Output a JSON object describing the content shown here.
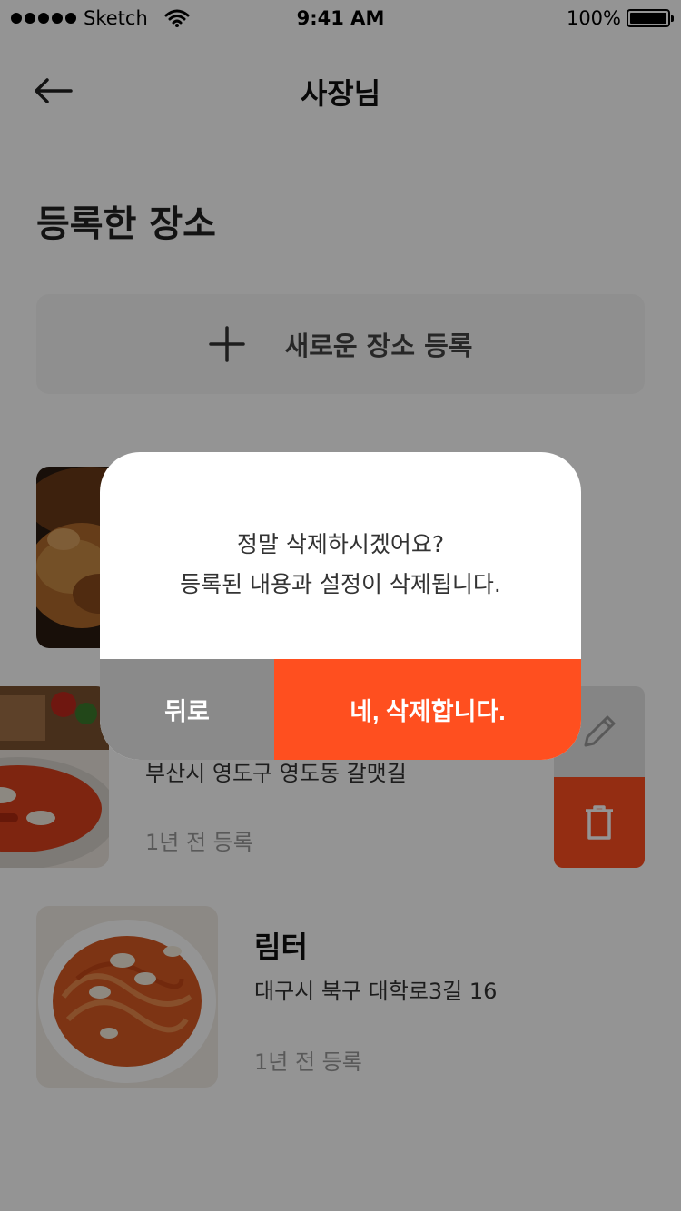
{
  "status_bar": {
    "carrier": "Sketch",
    "time": "9:41 AM",
    "battery": "100%"
  },
  "header": {
    "title": "사장님"
  },
  "section": {
    "title": "등록한 장소"
  },
  "add_card": {
    "label": "새로운 장소 등록"
  },
  "places": [
    {
      "name": "",
      "address": "",
      "registered": ""
    },
    {
      "name": "",
      "address": "부산시 영도구 영도동 갈맷길",
      "registered": "1년 전 등록"
    },
    {
      "name": "림터",
      "address": "대구시 북구 대학로3길 16",
      "registered": "1년 전 등록"
    }
  ],
  "dialog": {
    "line1": "정말 삭제하시겠어요?",
    "line2": "등록된 내용과 설정이 삭제됩니다.",
    "back_label": "뒤로",
    "confirm_label": "네, 삭제합니다."
  },
  "icons": {
    "back": "arrow-left-icon",
    "add": "plus-icon",
    "edit": "pencil-icon",
    "delete": "trash-icon"
  },
  "colors": {
    "accent": "#ff4f1f",
    "back_button": "#8a8a8a"
  }
}
